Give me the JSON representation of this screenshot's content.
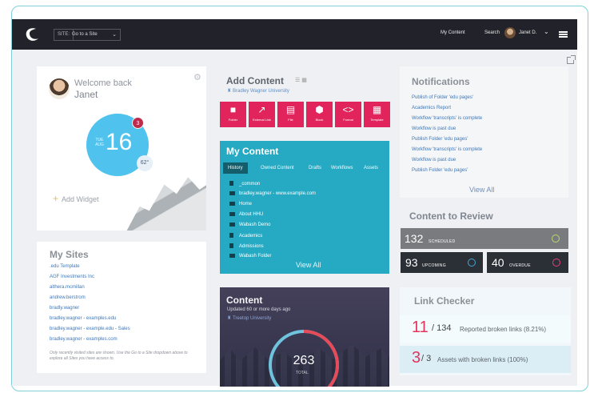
{
  "topbar": {
    "site_label": "SITE:",
    "site_select": "Go to a Site",
    "my_content": "My Content",
    "search": "Search",
    "user_name": "Janet D."
  },
  "welcome": {
    "greeting": "Welcome back",
    "name": "Janet",
    "day": "TUE",
    "month": "AUG",
    "date": "16",
    "badge": "3",
    "temperature": "62°",
    "add_widget": "Add Widget"
  },
  "my_sites": {
    "title": "My Sites",
    "sites": [
      ".edu Template",
      "AGF Investments Inc",
      "althera.mcmillan",
      "andrew.berstrom",
      "bradly.wagner",
      "bradley.wagner - examples.edu",
      "bradley.wagner - example.edu - Sales",
      "bradley.wagner - examples.com"
    ],
    "note": "Only recently visited sites are shown. Use the Go to a Site dropdown above to explore all Sites you have access to."
  },
  "add_content": {
    "title": "Add Content",
    "university": "Bradley Wagner University",
    "tiles": [
      "Folder",
      "External Link",
      "File",
      "Block",
      "Format",
      "Template"
    ]
  },
  "my_content": {
    "title": "My Content",
    "tabs": [
      "History",
      "Owned Content",
      "Drafts",
      "Workflows",
      "Assets"
    ],
    "items": [
      {
        "name": "_common",
        "type": "file"
      },
      {
        "name": "bradley.wagner - www.example.com",
        "type": "folder"
      },
      {
        "name": "Home",
        "type": "folder"
      },
      {
        "name": "About HHU",
        "type": "folder"
      },
      {
        "name": "Wabash Demo",
        "type": "folder"
      },
      {
        "name": "Academics",
        "type": "file"
      },
      {
        "name": "Admissions",
        "type": "file"
      },
      {
        "name": "Wabash Folder",
        "type": "folder"
      }
    ],
    "view_all": "View All"
  },
  "content_stats": {
    "title": "Content",
    "subtitle": "Updated 60 or more days ago",
    "university": "Treetop University",
    "total": "263",
    "total_label": "TOTAL",
    "gauge_fraction": 0.38
  },
  "notifications": {
    "title": "Notifications",
    "items": [
      "Publish of Folder 'edu pages'",
      "Academics Report",
      "Workflow 'transcripts' is complete",
      "Workflow is past due",
      "Publish Folder 'edu pages'",
      "Workflow 'transcripts' is complete",
      "Workflow is past due",
      "Publish Folder 'edu pages'"
    ],
    "view_all": "View All"
  },
  "review": {
    "title": "Content to Review",
    "scheduled": {
      "value": "132",
      "label": "SCHEDULED"
    },
    "upcoming": {
      "value": "93",
      "label": "UPCOMING"
    },
    "overdue": {
      "value": "40",
      "label": "OVERDUE"
    }
  },
  "link_checker": {
    "title": "Link Checker",
    "broken_count": "11",
    "total_count": "/ 134",
    "broken_text": "Reported broken links (8.21%)",
    "assets_count": "3",
    "assets_total": "/ 3",
    "assets_text": "Assets with broken links (100%)"
  },
  "colors": {
    "accent_pink": "#e2245c",
    "content_blue": "#26a9c2",
    "date_blue": "#4fc3ee",
    "topbar": "#22232a"
  },
  "icons": [
    "logo-icon",
    "gear-icon",
    "chevron-down-icon",
    "external-link-icon",
    "building-icon",
    "check-icon",
    "clock-icon",
    "alert-icon"
  ]
}
